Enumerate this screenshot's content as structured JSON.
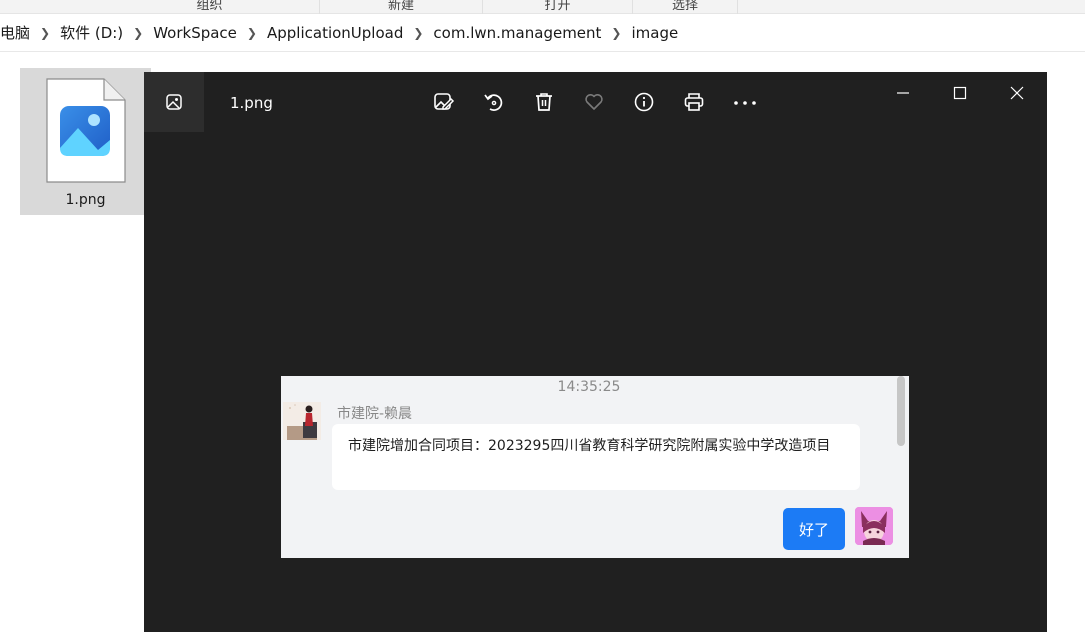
{
  "explorer": {
    "ribbon": [
      "组织",
      "新建",
      "打开",
      "选择"
    ],
    "breadcrumb": [
      "电脑",
      "软件 (D:)",
      "WorkSpace",
      "ApplicationUpload",
      "com.lwn.management",
      "image"
    ],
    "file": {
      "name": "1.png"
    }
  },
  "viewer": {
    "title": "1.png",
    "toolbar": [
      "edit-image-icon",
      "rotate-icon",
      "delete-icon",
      "favorite-icon",
      "info-icon",
      "print-icon",
      "more-icon"
    ],
    "colors": {
      "background": "#202020",
      "titlebar_accent": "#2d2d2d"
    }
  },
  "chat": {
    "timestamp": "14:35:25",
    "sender": "市建院-赖晨",
    "incoming_message": "市建院增加合同项目：2023295四川省教育科学研究院附属实验中学改造项目",
    "outgoing_message": "好了",
    "colors": {
      "outgoing_bubble": "#1c7bf5",
      "background": "#f2f3f5"
    }
  }
}
